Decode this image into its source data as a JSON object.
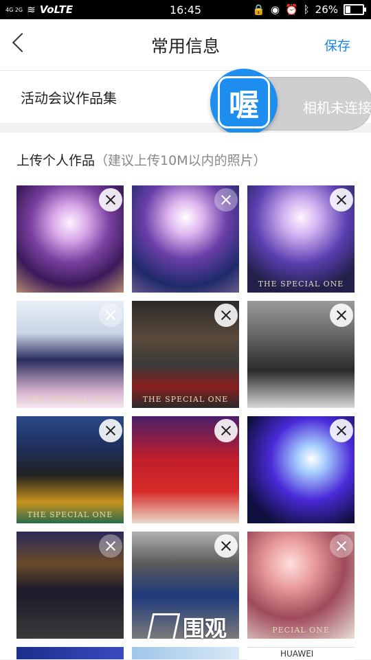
{
  "status_bar": {
    "network": "4G 2G",
    "volte": "VoLTE",
    "time": "16:45",
    "battery": "26%"
  },
  "header": {
    "title": "常用信息",
    "save_label": "保存"
  },
  "portfolio": {
    "label": "活动会议作品集"
  },
  "camera": {
    "badge_char": "喔",
    "status": "相机未连接"
  },
  "upload": {
    "title": "上传个人作品",
    "hint": "（建议上传10M以内的照片）"
  },
  "photos": [
    {
      "caption": "",
      "remove_style": "normal"
    },
    {
      "caption": "",
      "remove_style": "faint"
    },
    {
      "caption": "THE SPECIAL ONE",
      "remove_style": "normal"
    },
    {
      "caption": "THE SPECIAL ONE",
      "remove_style": "faint"
    },
    {
      "caption": "THE SPECIAL ONE",
      "remove_style": "normal"
    },
    {
      "caption": "",
      "remove_style": "normal"
    },
    {
      "caption": "THE SPECIAL ONE",
      "remove_style": "normal"
    },
    {
      "caption": "",
      "remove_style": "normal"
    },
    {
      "caption": "",
      "remove_style": "normal"
    },
    {
      "caption": "",
      "remove_style": "faint"
    },
    {
      "caption": "",
      "remove_style": "normal"
    },
    {
      "caption": "PECIAL ONE",
      "remove_style": "faint"
    }
  ],
  "bottom_row_partial": {
    "brand_text": "HUAWEI"
  },
  "watermark": {
    "text": "围观"
  }
}
